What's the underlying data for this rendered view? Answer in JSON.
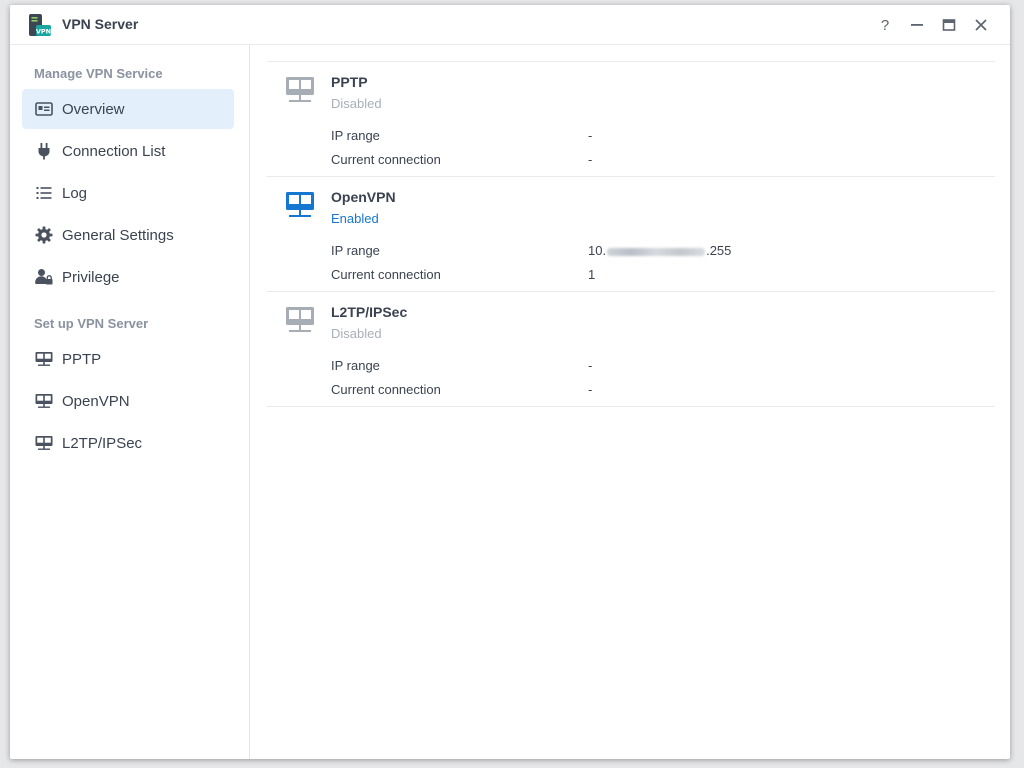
{
  "window": {
    "title": "VPN Server",
    "app_icon_text": "VPN",
    "controls": {
      "help": "?",
      "minimize": "minimize-icon",
      "maximize": "maximize-icon",
      "close": "close-icon"
    }
  },
  "sidebar": {
    "section_manage": "Manage VPN Service",
    "manage_items": [
      {
        "label": "Overview",
        "icon": "overview-icon",
        "active": true
      },
      {
        "label": "Connection List",
        "icon": "plug-icon"
      },
      {
        "label": "Log",
        "icon": "list-icon"
      },
      {
        "label": "General Settings",
        "icon": "gear-icon"
      },
      {
        "label": "Privilege",
        "icon": "user-lock-icon"
      }
    ],
    "section_setup": "Set up VPN Server",
    "setup_items": [
      {
        "label": "PPTP",
        "icon": "server-icon"
      },
      {
        "label": "OpenVPN",
        "icon": "server-icon"
      },
      {
        "label": "L2TP/IPSec",
        "icon": "server-icon"
      }
    ]
  },
  "services": [
    {
      "name": "PPTP",
      "status": "Disabled",
      "ip_range_label": "IP range",
      "ip_range": "-",
      "conn_label": "Current connection",
      "connections": "-"
    },
    {
      "name": "OpenVPN",
      "status": "Enabled",
      "ip_range_label": "IP range",
      "ip_prefix": "10.",
      "ip_suffix": ".255",
      "conn_label": "Current connection",
      "connections": "1"
    },
    {
      "name": "L2TP/IPSec",
      "status": "Disabled",
      "ip_range_label": "IP range",
      "ip_range": "-",
      "conn_label": "Current connection",
      "connections": "-"
    }
  ],
  "colors": {
    "accent": "#1677d2",
    "disabled_icon": "#a7adb5",
    "active_bg": "#e3f0fc"
  }
}
